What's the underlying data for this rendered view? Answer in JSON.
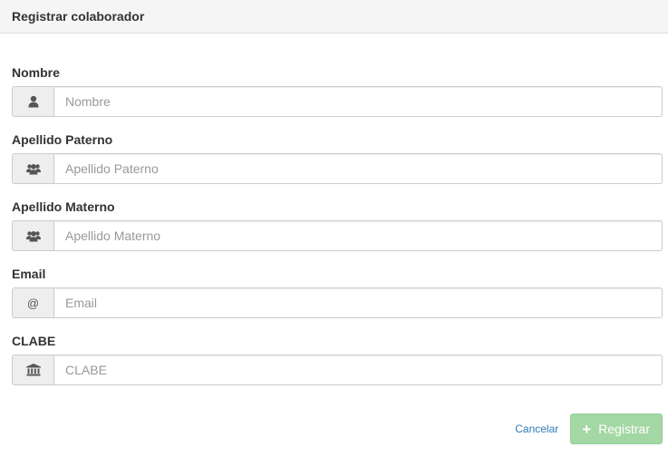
{
  "panel": {
    "title": "Registrar colaborador"
  },
  "fields": [
    {
      "label": "Nombre",
      "placeholder": "Nombre",
      "value": "",
      "icon": "user-icon"
    },
    {
      "label": "Apellido Paterno",
      "placeholder": "Apellido Paterno",
      "value": "",
      "icon": "users-icon"
    },
    {
      "label": "Apellido Materno",
      "placeholder": "Apellido Materno",
      "value": "",
      "icon": "users-icon"
    },
    {
      "label": "Email",
      "placeholder": "Email",
      "value": "",
      "icon": "at-icon",
      "icon_glyph": "@"
    },
    {
      "label": "CLABE",
      "placeholder": "CLABE",
      "value": "",
      "icon": "bank-icon"
    }
  ],
  "actions": {
    "cancel_label": "Cancelar",
    "submit_label": "Registrar",
    "submit_icon": "plus-icon",
    "submit_icon_glyph": "+"
  },
  "colors": {
    "link": "#337ab7",
    "submit_bg": "#a3d7a3",
    "heading_bg": "#f5f5f5"
  }
}
